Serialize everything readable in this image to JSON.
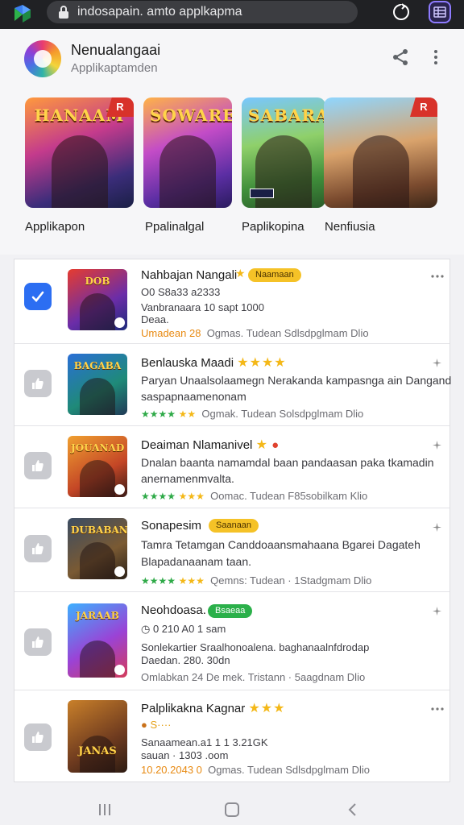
{
  "browser": {
    "url_text": "indosapain. amto applkapma"
  },
  "app_header": {
    "title": "Nenualangaai",
    "subtitle": "Applikaptamden"
  },
  "banners": [
    {
      "art": "HANAAM",
      "badge": "R"
    },
    {
      "art": "SOWARE",
      "badge": ""
    },
    {
      "art": "SABARAN",
      "badge": ""
    },
    {
      "art": "",
      "badge": "R"
    }
  ],
  "categories": [
    "Applikapon",
    "Ppalinalgal",
    "Paplikopina",
    "Nenfiusia"
  ],
  "list": [
    {
      "title": "Nahbajan Nangali",
      "pill": "Naamaan",
      "line1": "O0 S8a33 a2333",
      "line2": "Vanbranaara 10 sapt 1000",
      "line3": "Deaa.",
      "meta_prefix": "Umadean 28",
      "meta": "Ogmas. Tudean Sdlsdpglmam Dlio",
      "thumb_text": "DOB"
    },
    {
      "title": "Benlauska Maadi",
      "line1": "Paryan Unaalsolaamegn Nerakanda kampasnga ain Dangand",
      "line2": "saspapnaamenonam",
      "meta": "Ogmak. Tudean Solsdpglmam Dlio",
      "thumb_text": "BAGABA"
    },
    {
      "title": "Deaiman Nlamanivel",
      "line1": "Dnalan baanta namamdal baan pandaasan paka tkamadin",
      "line2": "anernamenmvalta.",
      "meta": "Oomac. Tudean F85sobilkam Klio",
      "thumb_text": "JOUANAD"
    },
    {
      "title": "Sonapesim",
      "pill": "Saanaan",
      "line1": "Tamra Tetamgan Canddoaansmahaana Bgarei Dagateh",
      "line2": "Blapadanaanam taan.",
      "meta": "Qemns: Tudean · 1Stadgmam Dlio",
      "thumb_text": "DUBABAN"
    },
    {
      "title": "Neohdoasa.",
      "pill": "Bsaeaa",
      "line1": "0 210 A0 1 sam",
      "line2": "Sonlekartier Sraalhonoalena. baghanaalnfdrodap",
      "line3": "Daedan.  280. 30dn",
      "meta": "Omlabkan 24  De mek. Tristann · 5aagdnam Dlio",
      "thumb_text": "JARAAB"
    },
    {
      "title": "Palplikakna Kagnar",
      "line1": "S····",
      "line2": "Sanaamean.a1 1 1 3.21GK",
      "line3": "sauan ·  1303 .oom",
      "meta_prefix": "10.20.2043 0",
      "meta": "Ogmas. Tudean Sdlsdpglmam Dlio",
      "thumb_text": "JANAS"
    }
  ]
}
